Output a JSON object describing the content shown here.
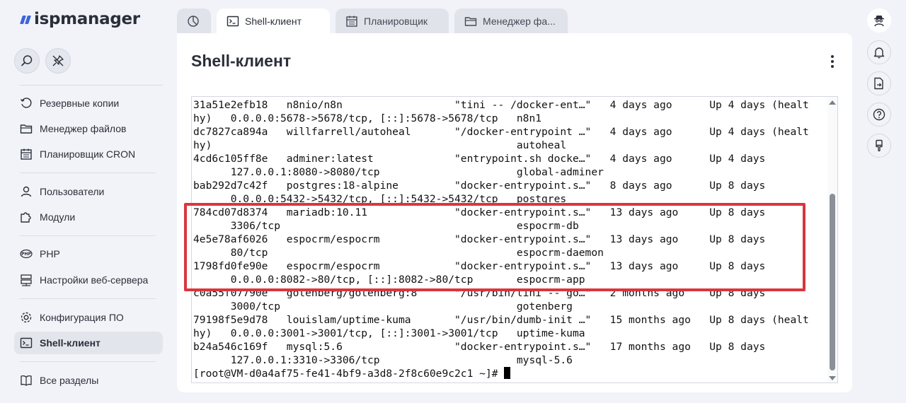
{
  "app": {
    "logo_text": "ispmanager"
  },
  "tabs": [
    {
      "label": "",
      "icon": "dashboard-pie-icon"
    },
    {
      "label": "Shell-клиент",
      "icon": "terminal-icon",
      "active": true
    },
    {
      "label": "Планировщик",
      "icon": "calendar-icon"
    },
    {
      "label": "Менеджер фа...",
      "icon": "folder-icon"
    }
  ],
  "sidebar": {
    "search_icon": "search-icon",
    "pin_icon": "unpin-icon",
    "items": [
      {
        "label": "Резервные копии",
        "icon": "backup-icon"
      },
      {
        "label": "Менеджер файлов",
        "icon": "folder-icon"
      },
      {
        "label": "Планировщик CRON",
        "icon": "calendar-icon"
      },
      {
        "label": "Пользователи",
        "icon": "user-icon"
      },
      {
        "label": "Модули",
        "icon": "puzzle-icon"
      },
      {
        "label": "PHP",
        "icon": "php-icon"
      },
      {
        "label": "Настройки веб-сервера",
        "icon": "server-icon"
      },
      {
        "label": "Конфигурация ПО",
        "icon": "gear-icon"
      },
      {
        "label": "Shell-клиент",
        "icon": "terminal-icon",
        "active": true
      },
      {
        "label": "Все разделы",
        "icon": "book-icon"
      }
    ]
  },
  "main": {
    "title": "Shell-клиент",
    "terminal": {
      "lines": [
        "31a51e2efb18   n8nio/n8n                  \"tini -- /docker-ent…\"   4 days ago      Up 4 days (healt",
        "hy)   0.0.0.0:5678->5678/tcp, [::]:5678->5678/tcp   n8n1",
        "dc7827ca894a   willfarrell/autoheal       \"/docker-entrypoint …\"   4 days ago      Up 4 days (healt",
        "hy)                                                 autoheal",
        "4cd6c105ff8e   adminer:latest             \"entrypoint.sh docke…\"   4 days ago      Up 4 days",
        "      127.0.0.1:8080->8080/tcp                      global-adminer",
        "bab292d7c42f   postgres:18-alpine         \"docker-entrypoint.s…\"   8 days ago      Up 8 days",
        "      0.0.0.0:5432->5432/tcp, [::]:5432->5432/tcp   postgres",
        "784cd07d8374   mariadb:10.11              \"docker-entrypoint.s…\"   13 days ago     Up 8 days",
        "      3306/tcp                                      espocrm-db",
        "4e5e78af6026   espocrm/espocrm            \"docker-entrypoint.s…\"   13 days ago     Up 8 days",
        "      80/tcp                                        espocrm-daemon",
        "1798fd0fe90e   espocrm/espocrm            \"docker-entrypoint.s…\"   13 days ago     Up 8 days",
        "      0.0.0.0:8082->80/tcp, [::]:8082->80/tcp       espocrm-app",
        "c0a55f07790e   gotenberg/gotenberg:8      \"/usr/bin/tini -- go…\"   2 months ago    Up 8 days",
        "      3000/tcp                                      gotenberg",
        "79198f5e9d78   louislam/uptime-kuma       \"/usr/bin/dumb-init …\"   15 months ago   Up 8 days (healt",
        "hy)   0.0.0.0:3001->3001/tcp, [::]:3001->3001/tcp   uptime-kuma",
        "b24a546c169f   mysql:5.6                  \"docker-entrypoint.s…\"   17 months ago   Up 8 days",
        "      127.0.0.1:3310->3306/tcp                      mysql-5.6"
      ],
      "prompt": "[root@VM-d0a4af75-fe41-4bf9-a3d8-2f8c60e9c2c1 ~]# "
    },
    "highlight_color": "#d9363e"
  },
  "right_rail": [
    {
      "icon": "user-agent-icon"
    },
    {
      "icon": "bell-icon"
    },
    {
      "icon": "file-export-icon"
    },
    {
      "icon": "help-icon"
    },
    {
      "icon": "brush-icon"
    }
  ]
}
